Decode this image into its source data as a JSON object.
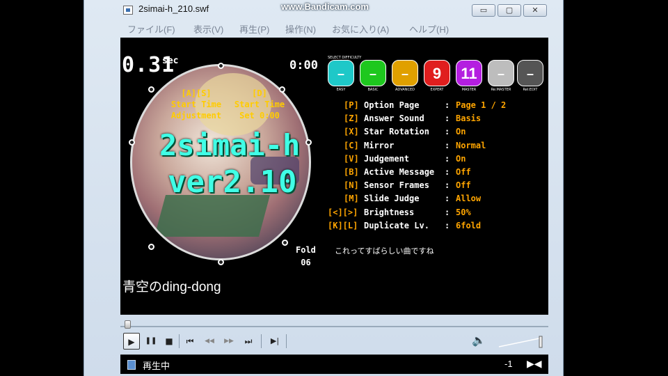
{
  "window": {
    "title": "2simai-h_210.swf",
    "watermark": "www.Bandicam.com",
    "buttons": {
      "minimize": "▭",
      "maximize": "▢",
      "close": "✕"
    }
  },
  "menu": [
    "ファイル(F)",
    "表示(V)",
    "再生(P)",
    "操作(N)",
    "お気に入り(A)",
    "ヘルプ(H)"
  ],
  "game": {
    "timer": "0.31",
    "timer_unit": "sec",
    "clock": "0:00",
    "jacket_left": [
      "[A][S]",
      "Start Time",
      "Adjustment"
    ],
    "jacket_right": [
      "[D]",
      "Start Time",
      "Set 0:00"
    ],
    "logo_line1": "2simai-h",
    "logo_line2": "ver2.10",
    "select_label": "SELECT DIFFICULTY",
    "difficulties": [
      {
        "label": "–",
        "color": "#1ec8c8",
        "caption": "EASY"
      },
      {
        "label": "–",
        "color": "#1ec81e",
        "caption": "BASIC"
      },
      {
        "label": "–",
        "color": "#e0a000",
        "caption": "ADVANCED"
      },
      {
        "label": "9",
        "color": "#e01e1e",
        "caption": "EXPERT"
      },
      {
        "label": "11",
        "color": "#b41ee0",
        "caption": "MASTER"
      },
      {
        "label": "–",
        "color": "#bdbdbd",
        "caption": "Re:MASTER"
      },
      {
        "label": "–",
        "color": "#555555",
        "caption": "Rel:EDIT"
      }
    ],
    "options": [
      {
        "key": "[P]",
        "name": "Option Page",
        "value": "Page 1 / 2"
      },
      {
        "key": "[Z]",
        "name": "Answer Sound",
        "value": "Basis"
      },
      {
        "key": "[X]",
        "name": "Star Rotation",
        "value": "On"
      },
      {
        "key": "[C]",
        "name": "Mirror",
        "value": "Normal"
      },
      {
        "key": "[V]",
        "name": "Judgement",
        "value": "On"
      },
      {
        "key": "[B]",
        "name": "Active Message",
        "value": "Off"
      },
      {
        "key": "[N]",
        "name": "Sensor Frames",
        "value": "Off"
      },
      {
        "key": "[M]",
        "name": "Slide Judge",
        "value": "Allow"
      },
      {
        "key": "[<][>]",
        "name": "Brightness",
        "value": "50%"
      },
      {
        "key": "[K][L]",
        "name": "Duplicate Lv.",
        "value": "6fold"
      }
    ],
    "fold_label": "Fold",
    "fold_value": "06",
    "comment": "これってすばらしい曲ですね",
    "song_title": "青空のding-dong"
  },
  "player": {
    "play": "▶",
    "pause": "❚❚",
    "stop": "■",
    "prev": "⏮",
    "rewind": "◀◀",
    "forward": "▶▶",
    "next": "⏭",
    "frame": "▶|",
    "volume": "🔈"
  },
  "status": {
    "text": "再生中",
    "value": "-1",
    "icon": "▶◀"
  }
}
